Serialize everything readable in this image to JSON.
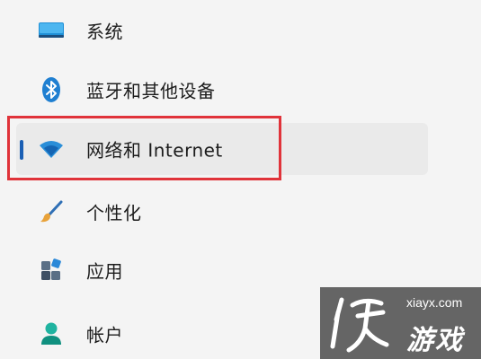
{
  "nav": {
    "items": [
      {
        "label": "系统",
        "icon": "monitor-icon"
      },
      {
        "label": "蓝牙和其他设备",
        "icon": "bluetooth-icon"
      },
      {
        "label": "网络和 Internet",
        "icon": "wifi-icon"
      },
      {
        "label": "个性化",
        "icon": "brush-icon"
      },
      {
        "label": "应用",
        "icon": "apps-icon"
      },
      {
        "label": "帐户",
        "icon": "person-icon"
      }
    ],
    "selected_index": 2
  },
  "colors": {
    "accent": "#1a5fb4",
    "highlight_frame": "#e0333a",
    "background": "#f4f4f4"
  },
  "watermark": {
    "domain": "xiayx.com",
    "name": "游戏"
  }
}
